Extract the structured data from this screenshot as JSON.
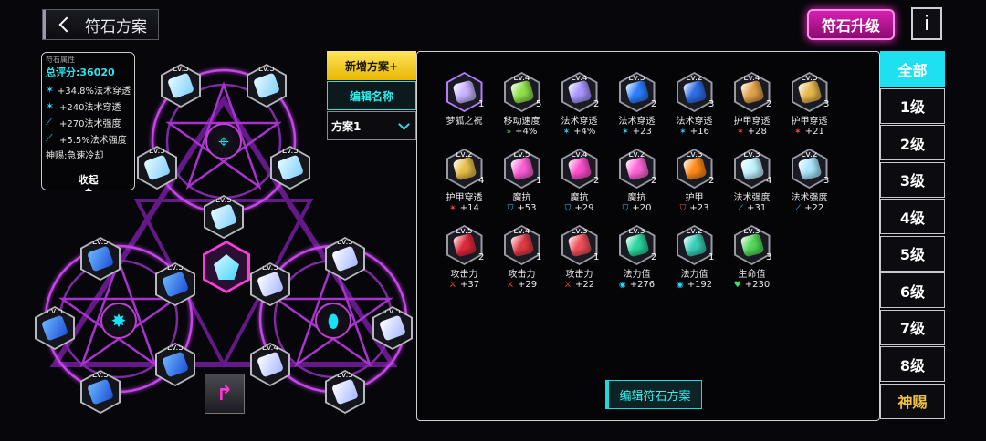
{
  "header": {
    "back_label": "符石方案",
    "upgrade_label": "符石升级",
    "info_label": "i"
  },
  "attr_panel": {
    "title": "符石属性",
    "score": "总评分:36020",
    "lines": [
      "+34.8%法术穿透",
      "+240法术穿透",
      "+270法术强度",
      "+5.5%法术强度"
    ],
    "god_effect": "神赐:急速冷却",
    "collapse_label": "收起"
  },
  "board": {
    "slot_level": "Lv.5",
    "bottom_slot_level": "Lv.4"
  },
  "plan": {
    "new_label": "新增方案+",
    "rename_label": "编辑名称",
    "selected": "方案1"
  },
  "inventory": {
    "edit_label": "编辑符石方案",
    "runes": [
      {
        "lv": "",
        "count": "1",
        "name": "梦狐之祝",
        "stat": "",
        "icon": "",
        "color": "#c9b4ff"
      },
      {
        "lv": "Lv.4",
        "count": "5",
        "name": "移动速度",
        "stat": "+4%",
        "icon": "speed-icon",
        "color": "#8fe04a"
      },
      {
        "lv": "Lv.4",
        "count": "2",
        "name": "法术穿透",
        "stat": "+4%",
        "icon": "pierce-icon",
        "color": "#a996ff"
      },
      {
        "lv": "Lv.3",
        "count": "2",
        "name": "法术穿透",
        "stat": "+23",
        "icon": "pierce-icon",
        "color": "#2b7fff"
      },
      {
        "lv": "Lv.2",
        "count": "3",
        "name": "法术穿透",
        "stat": "+16",
        "icon": "pierce-icon",
        "color": "#2f6ee8"
      },
      {
        "lv": "Lv.4",
        "count": "2",
        "name": "护甲穿透",
        "stat": "+28",
        "icon": "armor-pierce-icon",
        "color": "#e2a24a"
      },
      {
        "lv": "Lv.3",
        "count": "3",
        "name": "护甲穿透",
        "stat": "+21",
        "icon": "armor-pierce-icon",
        "color": "#e7b84c"
      },
      {
        "lv": "Lv.2",
        "count": "4",
        "name": "护甲穿透",
        "stat": "+14",
        "icon": "armor-pierce-icon",
        "color": "#e8c04a"
      },
      {
        "lv": "Lv.5",
        "count": "1",
        "name": "魔抗",
        "stat": "+53",
        "icon": "magic-resist-icon",
        "color": "#ff5fd8"
      },
      {
        "lv": "Lv.4",
        "count": "2",
        "name": "魔抗",
        "stat": "+29",
        "icon": "magic-resist-icon",
        "color": "#ff4fcf"
      },
      {
        "lv": "Lv.2",
        "count": "2",
        "name": "魔抗",
        "stat": "+20",
        "icon": "magic-resist-icon",
        "color": "#ff66d6"
      },
      {
        "lv": "Lv.3",
        "count": "2",
        "name": "护甲",
        "stat": "+23",
        "icon": "armor-icon",
        "color": "#ff8a1a"
      },
      {
        "lv": "Lv.3",
        "count": "4",
        "name": "法术强度",
        "stat": "+31",
        "icon": "spell-power-icon",
        "color": "#bff4ff"
      },
      {
        "lv": "Lv.2",
        "count": "3",
        "name": "法术强度",
        "stat": "+22",
        "icon": "spell-power-icon",
        "color": "#a9e6ff"
      },
      {
        "lv": "Lv.5",
        "count": "2",
        "name": "攻击力",
        "stat": "+37",
        "icon": "attack-icon",
        "color": "#e02a3c"
      },
      {
        "lv": "Lv.4",
        "count": "1",
        "name": "攻击力",
        "stat": "+29",
        "icon": "attack-icon",
        "color": "#e23a44"
      },
      {
        "lv": "Lv.3",
        "count": "1",
        "name": "攻击力",
        "stat": "+22",
        "icon": "attack-icon",
        "color": "#f2505a"
      },
      {
        "lv": "Lv.3",
        "count": "2",
        "name": "法力值",
        "stat": "+276",
        "icon": "mana-icon",
        "color": "#2ad7a0"
      },
      {
        "lv": "Lv.2",
        "count": "1",
        "name": "法力值",
        "stat": "+192",
        "icon": "mana-icon",
        "color": "#3ad0b8"
      },
      {
        "lv": "Lv.3",
        "count": "3",
        "name": "生命值",
        "stat": "+230",
        "icon": "health-icon",
        "color": "#52d85a"
      }
    ]
  },
  "tabs": [
    "全部",
    "1级",
    "2级",
    "3级",
    "4级",
    "5级",
    "6级",
    "7级",
    "8级",
    "神赐"
  ]
}
